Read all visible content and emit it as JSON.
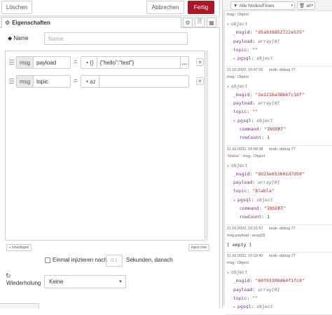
{
  "toolbar": {
    "delete_label": "Löschen",
    "cancel_label": "Abbrechen",
    "done_label": "Fertig"
  },
  "tabs": {
    "properties_label": "Eigenschaften"
  },
  "name_field": {
    "label": "Name",
    "placeholder": "Name"
  },
  "props": [
    {
      "type": "msg",
      "property": "payload",
      "value_type": "{}",
      "value": "{\"hello\":\"test\"}"
    },
    {
      "type": "msg",
      "property": "topic",
      "value_type": "az",
      "value": ""
    }
  ],
  "add_button_label": "+ hinzufügen",
  "inject_now_label": "inject now",
  "once": {
    "label": "Einmal injizieren nach",
    "delay_placeholder": "0.1",
    "suffix": "Sekunden, danach"
  },
  "repeat": {
    "label": "Wiederholung",
    "value": "Keine"
  },
  "debug": {
    "filter_label": "Alle Nodes/Flows",
    "clear_label": "all",
    "messages": [
      {
        "meta": "msg : Object",
        "lines": [
          {
            "indent": 0,
            "arrow": "▾",
            "key": "",
            "val": "object",
            "vtype": "obj"
          },
          {
            "indent": 1,
            "arrow": "",
            "key": "_msgid:",
            "val": "\"d5a938852722e535\"",
            "vtype": "str"
          },
          {
            "indent": 1,
            "arrow": "",
            "key": "payload:",
            "val": "array[0]",
            "vtype": "typ"
          },
          {
            "indent": 1,
            "arrow": "",
            "key": "topic:",
            "val": "\"\"",
            "vtype": "str"
          },
          {
            "indent": 1,
            "arrow": "▸",
            "key": "pgsql:",
            "val": "object",
            "vtype": "obj"
          }
        ]
      },
      {
        "meta_time": "11.10.2022, 10:47:52",
        "meta_node": "node: debug 77",
        "meta": "msg : Object",
        "lines": [
          {
            "indent": 0,
            "arrow": "▾",
            "key": "",
            "val": "object",
            "vtype": "obj"
          },
          {
            "indent": 1,
            "arrow": "",
            "key": "_msgid:",
            "val": "\"3a121ba38b67c16f\"",
            "vtype": "str"
          },
          {
            "indent": 1,
            "arrow": "",
            "key": "payload:",
            "val": "array[0]",
            "vtype": "typ"
          },
          {
            "indent": 1,
            "arrow": "",
            "key": "topic:",
            "val": "\"\"",
            "vtype": "str"
          },
          {
            "indent": 1,
            "arrow": "▾",
            "key": "pgsql:",
            "val": "object",
            "vtype": "obj"
          },
          {
            "indent": 2,
            "arrow": "",
            "key": "command:",
            "val": "\"INSERT\"",
            "vtype": "str"
          },
          {
            "indent": 2,
            "arrow": "",
            "key": "rowCount:",
            "val": "1",
            "vtype": "num"
          }
        ]
      },
      {
        "meta_time": "11.10.2022, 09:49:38",
        "meta_node": "node: debug 77",
        "meta_topic": "\"blabla\"",
        "meta": ": msg : Object",
        "lines": [
          {
            "indent": 0,
            "arrow": "▾",
            "key": "",
            "val": "object",
            "vtype": "obj"
          },
          {
            "indent": 1,
            "arrow": "",
            "key": "_msgid:",
            "val": "\"dd23e653601d7d50\"",
            "vtype": "str"
          },
          {
            "indent": 1,
            "arrow": "",
            "key": "payload:",
            "val": "array[0]",
            "vtype": "typ"
          },
          {
            "indent": 1,
            "arrow": "",
            "key": "topic:",
            "val": "\"blabla\"",
            "vtype": "str"
          },
          {
            "indent": 1,
            "arrow": "▾",
            "key": "pgsql:",
            "val": "object",
            "vtype": "obj"
          },
          {
            "indent": 2,
            "arrow": "",
            "key": "command:",
            "val": "\"INSERT\"",
            "vtype": "str"
          },
          {
            "indent": 2,
            "arrow": "",
            "key": "rowCount:",
            "val": "1",
            "vtype": "num"
          }
        ]
      },
      {
        "meta_time": "11.10.2022, 10:21:57",
        "meta_node": "node: debug 77",
        "meta": "msg.payload : array[0]",
        "lines": [
          {
            "indent": 0,
            "arrow": "",
            "key": "",
            "val": "[ empty ]",
            "vtype": "plain"
          }
        ]
      },
      {
        "meta_time": "11.10.2022, 10:23:40",
        "meta_node": "node: debug 77",
        "meta": "msg : Object",
        "lines": [
          {
            "indent": 0,
            "arrow": "▾",
            "key": "",
            "val": "object",
            "vtype": "obj"
          },
          {
            "indent": 1,
            "arrow": "",
            "key": "_msgid:",
            "val": "\"60f03308d64f1fc8\"",
            "vtype": "str"
          },
          {
            "indent": 1,
            "arrow": "",
            "key": "payload:",
            "val": "array[0]",
            "vtype": "typ"
          },
          {
            "indent": 1,
            "arrow": "",
            "key": "topic:",
            "val": "\"\"",
            "vtype": "str"
          },
          {
            "indent": 1,
            "arrow": "▸",
            "key": "pgsql:",
            "val": "object",
            "vtype": "obj"
          }
        ]
      }
    ]
  }
}
